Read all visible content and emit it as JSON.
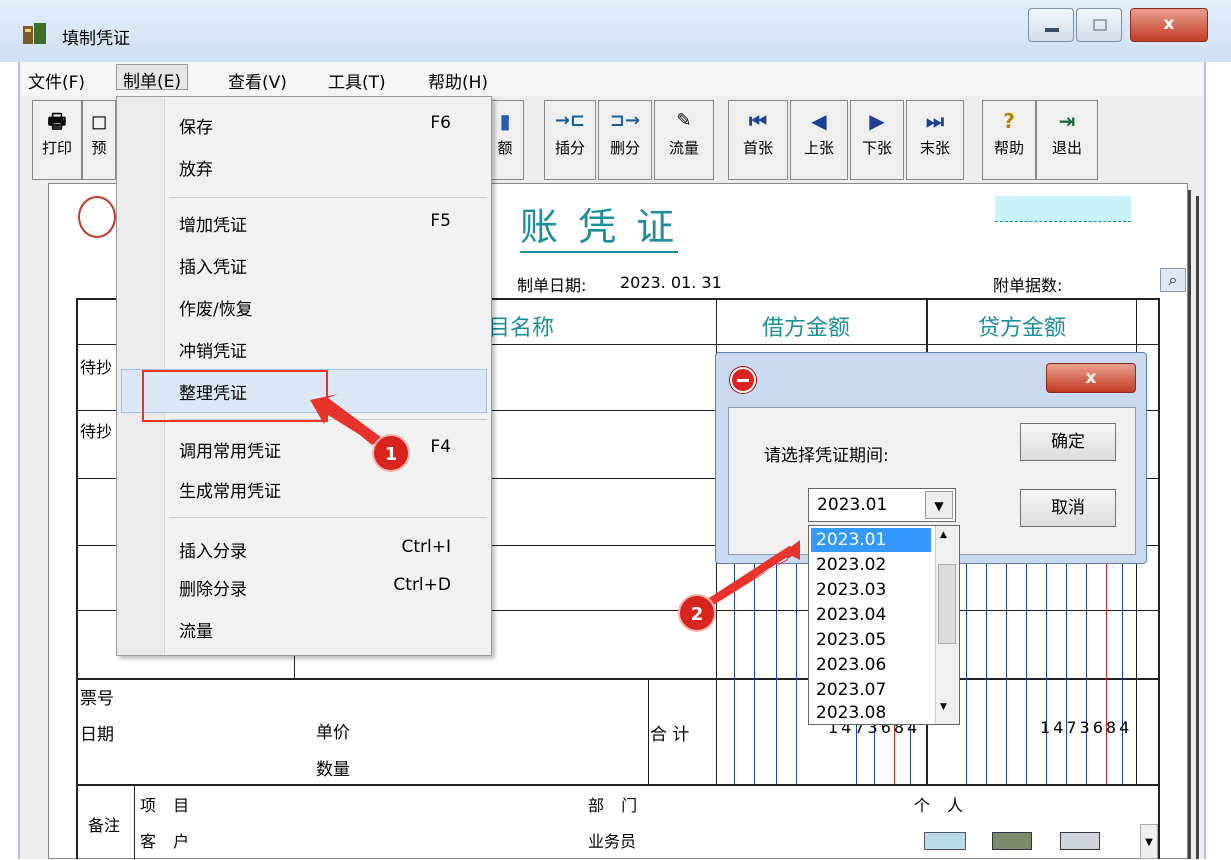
{
  "window": {
    "title": "填制凭证",
    "close_glyph": "x"
  },
  "menubar": [
    "文件(F)",
    "制单(E)",
    "查看(V)",
    "工具(T)",
    "帮助(H)"
  ],
  "toolbar": {
    "print": "打印",
    "preview": "预",
    "amount": "额",
    "insert_split": "插分",
    "delete_split": "删分",
    "flow": "流量",
    "first": "首张",
    "prev": "上张",
    "next": "下张",
    "last": "末张",
    "help": "帮助",
    "exit": "退出"
  },
  "voucher": {
    "title": "账 凭 证",
    "date_label": "制单日期:",
    "date": "2023. 01. 31",
    "attachments_label": "附单据数:",
    "col_subject": "目名称",
    "col_debit": "借方金额",
    "col_credit": "贷方金额",
    "row1": "待抄",
    "row2": "待抄",
    "ticket_no": "票号",
    "date_row": "日期",
    "unit_price": "单价",
    "quantity": "数量",
    "total": "合 计",
    "total_debit": "1473684",
    "total_credit": "1473684",
    "remark": "备注",
    "project": "项 目",
    "customer": "客 户",
    "department": "部 门",
    "salesman": "业务员",
    "individual": "个 人"
  },
  "edit_menu": {
    "items": [
      {
        "label": "保存",
        "shortcut": "F6"
      },
      {
        "label": "放弃",
        "shortcut": ""
      },
      {
        "label": "增加凭证",
        "shortcut": "F5"
      },
      {
        "label": "插入凭证",
        "shortcut": ""
      },
      {
        "label": "作废/恢复",
        "shortcut": ""
      },
      {
        "label": "冲销凭证",
        "shortcut": ""
      },
      {
        "label": "整理凭证",
        "shortcut": ""
      },
      {
        "label": "调用常用凭证",
        "shortcut": "F4"
      },
      {
        "label": "生成常用凭证",
        "shortcut": ""
      },
      {
        "label": "插入分录",
        "shortcut": "Ctrl+I"
      },
      {
        "label": "删除分录",
        "shortcut": "Ctrl+D"
      },
      {
        "label": "流量",
        "shortcut": ""
      }
    ]
  },
  "dialog": {
    "prompt": "请选择凭证期间:",
    "selected": "2023.01",
    "ok": "确定",
    "cancel": "取消",
    "options": [
      "2023.01",
      "2023.02",
      "2023.03",
      "2023.04",
      "2023.05",
      "2023.06",
      "2023.07",
      "2023.08"
    ]
  },
  "annotations": {
    "step1": "1",
    "step2": "2"
  },
  "colors": {
    "highlight_box": "#e8322c",
    "arrow": "#e8322c",
    "selected_option": "#3399ff"
  }
}
